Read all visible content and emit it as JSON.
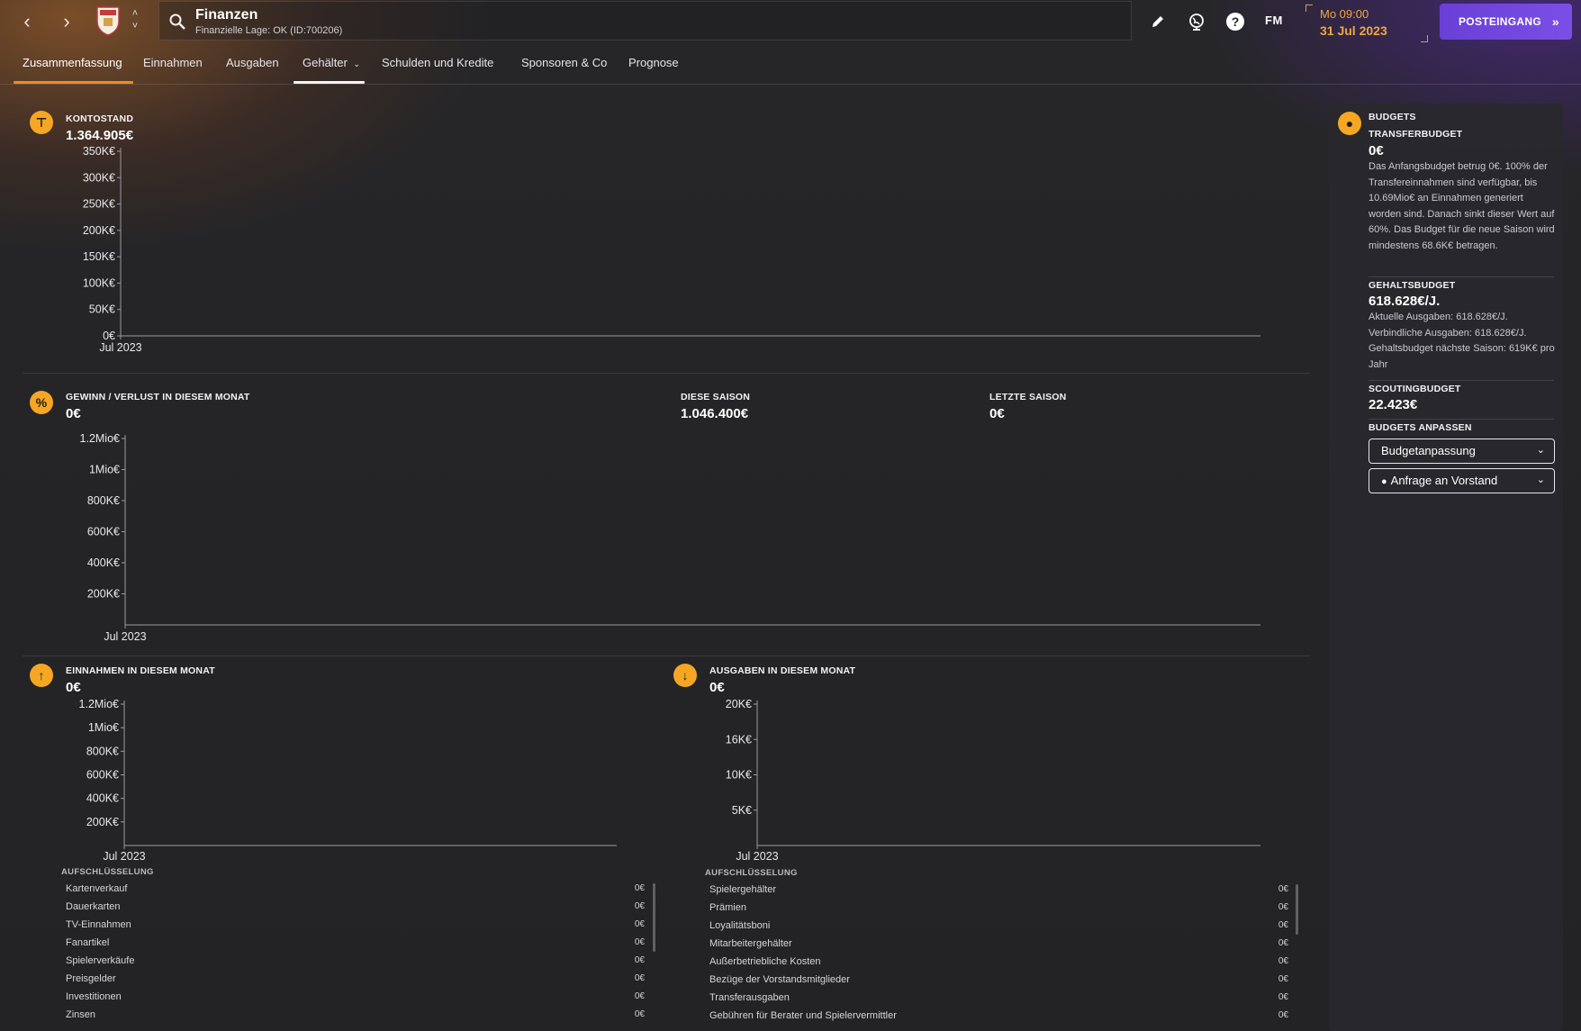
{
  "header": {
    "title": "Finanzen",
    "subtitle": "Finanzielle Lage: OK (ID:700206)",
    "time": "Mo 09:00",
    "date": "31 Jul 2023",
    "fm_label": "FM",
    "inbox_label": "POSTEINGANG",
    "icons": [
      "back-arrow-icon",
      "forward-arrow-icon",
      "club-crest",
      "up-down-chevron-icon",
      "search-icon",
      "pencil-icon",
      "globe-icon",
      "help-icon",
      "double-chevron-right-icon"
    ]
  },
  "tabs": [
    {
      "label": "Zusammenfassung",
      "active": true
    },
    {
      "label": "Einnahmen"
    },
    {
      "label": "Ausgaben"
    },
    {
      "label": "Gehälter",
      "dropdown": true
    },
    {
      "label": "Schulden und Kredite"
    },
    {
      "label": "Sponsoren & Co"
    },
    {
      "label": "Prognose"
    }
  ],
  "balance": {
    "label": "KONTOSTAND",
    "value": "1.364.905€"
  },
  "profit": {
    "label": "GEWINN / VERLUST IN DIESEM MONAT",
    "value": "0€",
    "season_label": "DIESE SAISON",
    "season_value": "1.046.400€",
    "last_season_label": "LETZTE SAISON",
    "last_season_value": "0€"
  },
  "income": {
    "label": "EINNAHMEN IN DIESEM MONAT",
    "value": "0€",
    "breakdown_title": "AUFSCHLÜSSELUNG",
    "rows": [
      {
        "label": "Kartenverkauf",
        "value": "0€"
      },
      {
        "label": "Dauerkarten",
        "value": "0€"
      },
      {
        "label": "TV-Einnahmen",
        "value": "0€"
      },
      {
        "label": "Fanartikel",
        "value": "0€"
      },
      {
        "label": "Spielerverkäufe",
        "value": "0€"
      },
      {
        "label": "Preisgelder",
        "value": "0€"
      },
      {
        "label": "Investitionen",
        "value": "0€"
      },
      {
        "label": "Zinsen",
        "value": "0€"
      }
    ]
  },
  "expenses": {
    "label": "AUSGABEN IN DIESEM MONAT",
    "value": "0€",
    "breakdown_title": "AUFSCHLÜSSELUNG",
    "rows": [
      {
        "label": "Spielergehälter",
        "value": "0€"
      },
      {
        "label": "Prämien",
        "value": "0€"
      },
      {
        "label": "Loyalitätsboni",
        "value": "0€"
      },
      {
        "label": "Mitarbeitergehälter",
        "value": "0€"
      },
      {
        "label": "Außerbetriebliche Kosten",
        "value": "0€"
      },
      {
        "label": "Bezüge der Vorstandsmitglieder",
        "value": "0€"
      },
      {
        "label": "Transferausgaben",
        "value": "0€"
      },
      {
        "label": "Gebühren für Berater und Spielervermittler",
        "value": "0€"
      }
    ]
  },
  "budgets": {
    "label": "BUDGETS",
    "transfer_label": "TRANSFERBUDGET",
    "transfer_value": "0€",
    "transfer_text": "Das Anfangsbudget betrug 0€. 100% der Transfereinnahmen sind verfügbar, bis 10.69Mio€ an Einnahmen generiert worden sind. Danach sinkt dieser Wert auf 60%. Das Budget für die neue Saison wird mindestens 68.6K€ betragen.",
    "wage_label": "GEHALTSBUDGET",
    "wage_value": "618.628€/J.",
    "wage_text": "Aktuelle Ausgaben: 618.628€/J. Verbindliche Ausgaben: 618.628€/J. Gehaltsbudget nächste Saison: 619K€ pro Jahr",
    "scouting_label": "SCOUTINGBUDGET",
    "scouting_value": "22.423€",
    "adjust_label": "BUDGETS ANPASSEN",
    "select1": "Budgetanpassung",
    "select2": "Anfrage an Vorstand"
  },
  "chart_data": [
    {
      "type": "line",
      "title": "KONTOSTAND",
      "x": [
        "Jul 2023"
      ],
      "y_ticks": [
        "350K€",
        "300K€",
        "250K€",
        "200K€",
        "150K€",
        "100K€",
        "50K€",
        "0€"
      ],
      "ylim": [
        0,
        350000
      ],
      "series": []
    },
    {
      "type": "bar",
      "title": "GEWINN / VERLUST IN DIESEM MONAT",
      "x": [
        "Jul 2023"
      ],
      "y_ticks": [
        "1.2Mio€",
        "1Mio€",
        "800K€",
        "600K€",
        "400K€",
        "200K€"
      ],
      "ylim": [
        0,
        1200000
      ],
      "series": []
    },
    {
      "type": "bar",
      "title": "EINNAHMEN IN DIESEM MONAT",
      "x": [
        "Jul 2023"
      ],
      "y_ticks": [
        "1.2Mio€",
        "1Mio€",
        "800K€",
        "600K€",
        "400K€",
        "200K€"
      ],
      "ylim": [
        0,
        1200000
      ],
      "series": []
    },
    {
      "type": "bar",
      "title": "AUSGABEN IN DIESEM MONAT",
      "x": [
        "Jul 2023"
      ],
      "y_ticks": [
        "20K€",
        "16K€",
        "10K€",
        "5K€"
      ],
      "ylim": [
        0,
        20000
      ],
      "series": []
    }
  ]
}
